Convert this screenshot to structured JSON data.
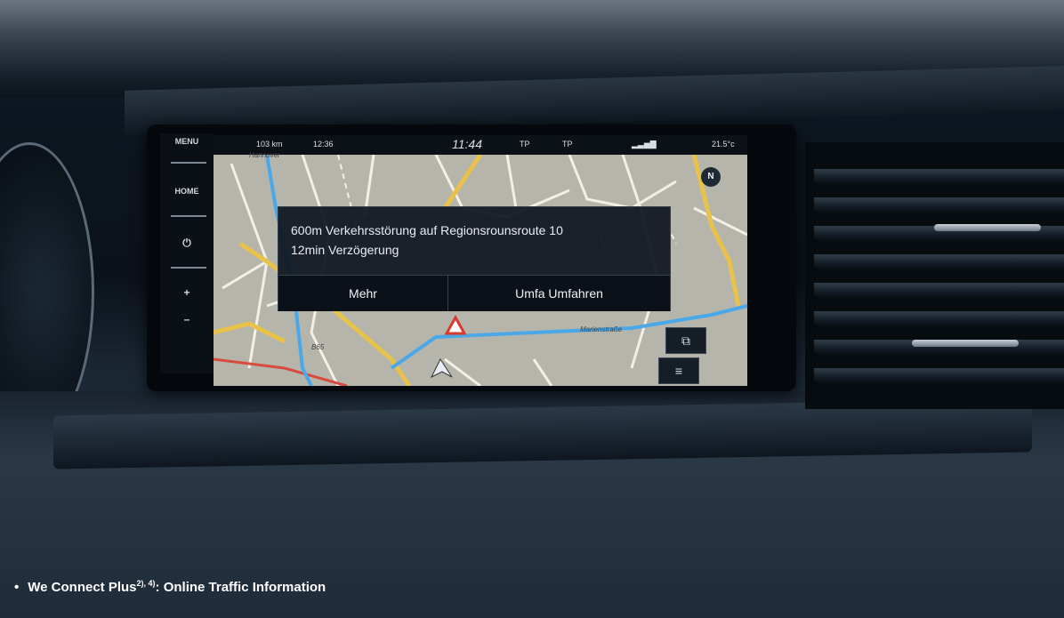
{
  "head_unit": {
    "rail": {
      "menu_label": "MENU",
      "home_label": "HOME",
      "power_symbol": "⏻",
      "plus_symbol": "+",
      "minus_symbol": "–"
    },
    "status_bar": {
      "distance": "103 km",
      "eta": "12:36",
      "time": "11:44",
      "tp_left": "TP",
      "tp_right": "TP",
      "temperature": "21.5°c"
    },
    "map": {
      "city_label": "Hannover",
      "street_label": "Marienstraße",
      "route_label": "B65",
      "compass_label": "N"
    },
    "traffic_popup": {
      "line1": "600m Verkehrsstörung auf Regionsrounsroute 10",
      "line2": "12min Verzögerung",
      "more_button": "Mehr",
      "detour_button": "Umfa Umfahren"
    },
    "map_buttons": {
      "view_icon": "map-view-icon",
      "menu_icon": "menu-icon"
    }
  },
  "caption": {
    "bullet": "•",
    "title_prefix": "We Connect Plus",
    "superscript": "2), 4)",
    "title_suffix": ": Online Traffic Information"
  },
  "colors": {
    "screen_bg": "#b6b5ab",
    "route_blue": "#4aa8e8",
    "road_yellow": "#e8c24a",
    "popup_bg": "#0e1620",
    "caption_text": "#ffffff"
  }
}
